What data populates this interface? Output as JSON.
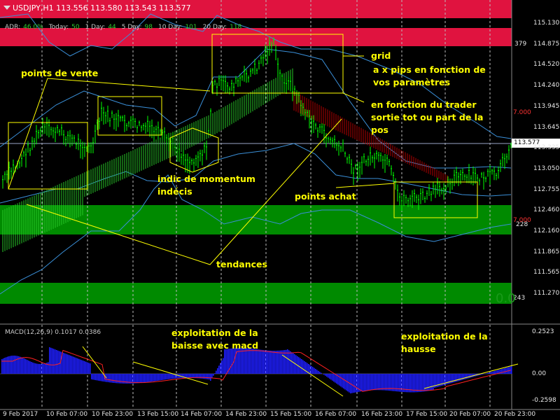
{
  "header": {
    "symbol_line": "USDJPY,H1  113.556 113.580 113.543 113.577",
    "adr": [
      {
        "label": "ADR:",
        "value": "46.0%"
      },
      {
        "label": "Today:",
        "value": "50"
      },
      {
        "label": "1 Day:",
        "value": "44"
      },
      {
        "label": "5 Day:",
        "value": "98"
      },
      {
        "label": "10 Day:",
        "value": "101"
      },
      {
        "label": "20 Day:",
        "value": "118"
      }
    ]
  },
  "colors": {
    "background": "#000000",
    "red_zone": "#e0133f",
    "green_zone": "#008a00",
    "candle": "#00ff00",
    "annotation": "#ffff00",
    "band": "#3a8fd8",
    "macd_hist": "#1f1fff",
    "macd_signal": "#ff2020"
  },
  "price_axis": [
    "115.130",
    "114.875",
    "114.520",
    "114.240",
    "113.945",
    "113.645",
    "113.335",
    "113.050",
    "112.755",
    "112.460",
    "112.160",
    "111.865",
    "111.565",
    "111.270"
  ],
  "current_price": "113.577",
  "zone_labels": {
    "top_red": "379",
    "lower_green": "228",
    "bottom_green": "243",
    "big_zero": "0.0"
  },
  "level_labels": {
    "upper": "7.000",
    "lower": "7.000"
  },
  "time_axis": [
    "9 Feb 2017",
    "10 Feb 07:00",
    "10 Feb 23:00",
    "13 Feb 15:00",
    "14 Feb 07:00",
    "14 Feb 23:00",
    "15 Feb 15:00",
    "16 Feb 07:00",
    "16 Feb 23:00",
    "17 Feb 15:00",
    "20 Feb 07:00",
    "20 Feb 23:00"
  ],
  "macd": {
    "title": "MACD(12,26,9) 0.1017 0.0386",
    "axis": [
      "0.2523",
      "0.00",
      "-0.2598"
    ]
  },
  "annotations": {
    "points_vente": "points de vente",
    "grid_title": "grid",
    "grid_desc": "a x pips en fonction de vos paramètres",
    "trader_desc": "en fonction du trader sortie tot ou part de la pos",
    "momentum": "indic de momentum indécis",
    "points_achat": "points achat",
    "tendances": "tendances",
    "baisse": "exploitation de la baisse avec macd",
    "hausse": "exploitation de la hausse"
  }
}
